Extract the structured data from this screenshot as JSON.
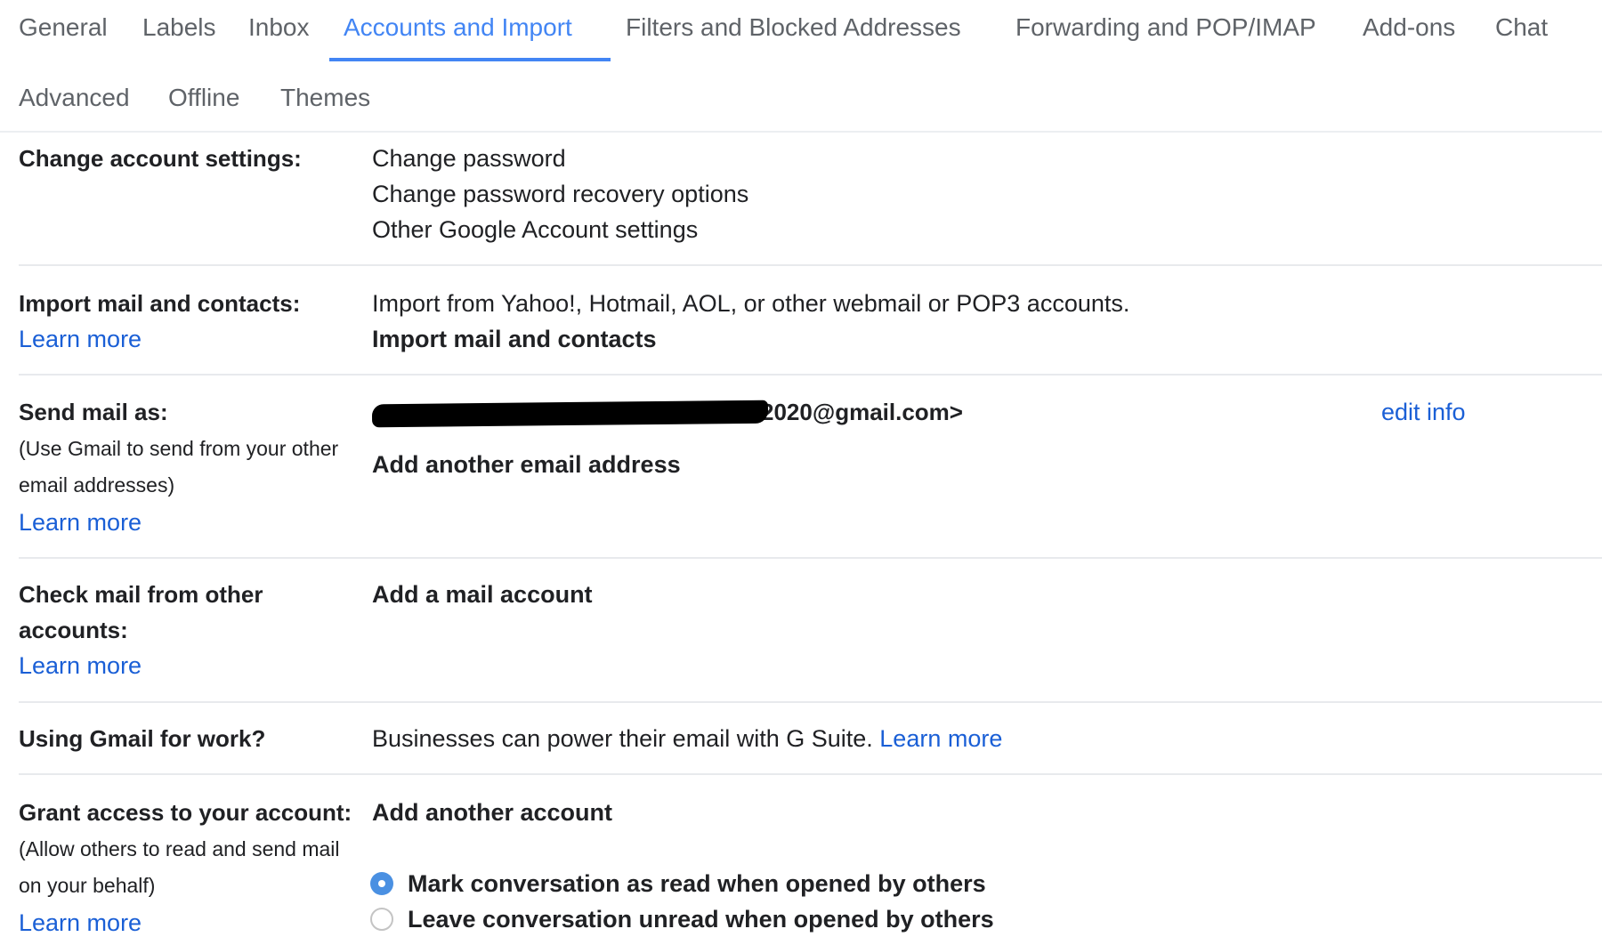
{
  "tabs": {
    "row1": [
      {
        "label": "General",
        "active": false
      },
      {
        "label": "Labels",
        "active": false
      },
      {
        "label": "Inbox",
        "active": false
      },
      {
        "label": "Accounts and Import",
        "active": true
      },
      {
        "label": "Filters and Blocked Addresses",
        "active": false
      },
      {
        "label": "Forwarding and POP/IMAP",
        "active": false
      },
      {
        "label": "Add-ons",
        "active": false
      },
      {
        "label": "Chat",
        "active": false
      }
    ],
    "row2": [
      {
        "label": "Advanced",
        "active": false
      },
      {
        "label": "Offline",
        "active": false
      },
      {
        "label": "Themes",
        "active": false
      }
    ]
  },
  "accent_color": "#4285f4",
  "link_color": "#1a5fd6",
  "sections": {
    "change_account": {
      "label": "Change account settings:",
      "links": [
        "Change password",
        "Change password recovery options",
        "Other Google Account settings"
      ]
    },
    "import": {
      "label": "Import mail and contacts:",
      "learn_more": "Learn more",
      "description": "Import from Yahoo!, Hotmail, AOL, or other webmail or POP3 accounts.",
      "action": "Import mail and contacts"
    },
    "send_mail_as": {
      "label": "Send mail as:",
      "sub_line1": "(Use Gmail to send from your other",
      "sub_line2": "email addresses)",
      "learn_more": "Learn more",
      "email_visible": "2020@gmail.com>",
      "email_redacted": true,
      "edit": "edit info",
      "action": "Add another email address"
    },
    "check_mail": {
      "label_line1": "Check mail from other",
      "label_line2": "accounts:",
      "learn_more": "Learn more",
      "action": "Add a mail account"
    },
    "gmail_work": {
      "label": "Using Gmail for work?",
      "description": "Businesses can power their email with G Suite.",
      "learn_more": "Learn more"
    },
    "grant_access": {
      "label": "Grant access to your account:",
      "sub_line1": "(Allow others to read and send mail",
      "sub_line2": "on your behalf)",
      "learn_more": "Learn more",
      "action": "Add another account",
      "options": [
        {
          "label": "Mark conversation as read when opened by others",
          "selected": true
        },
        {
          "label": "Leave conversation unread when opened by others",
          "selected": false
        }
      ]
    }
  }
}
